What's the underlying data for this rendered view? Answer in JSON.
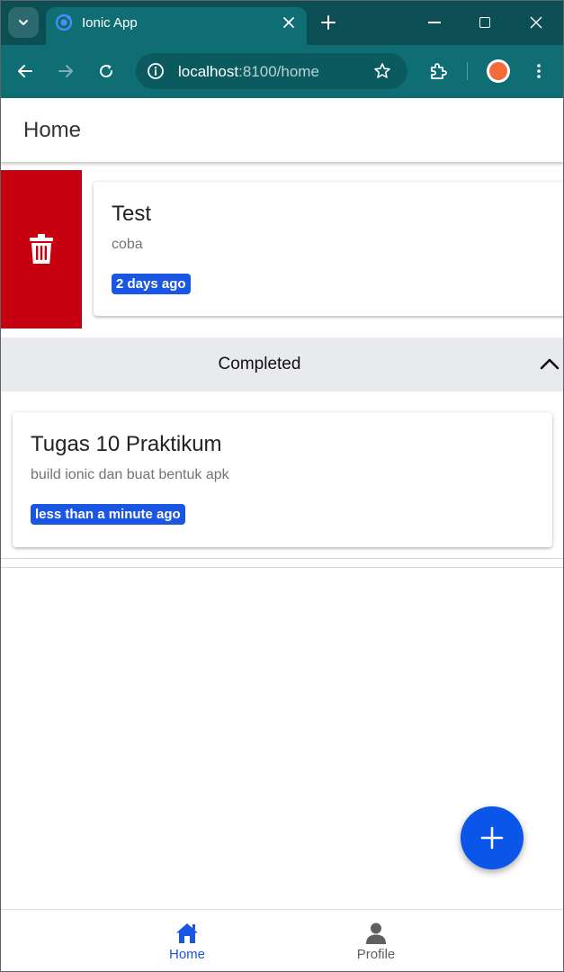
{
  "browser": {
    "tab_title": "Ionic App",
    "url_host": "localhost",
    "url_path": ":8100/home",
    "colors": {
      "tabstrip": "#0b4f55",
      "toolbar": "#0f6e73"
    }
  },
  "app": {
    "header_title": "Home",
    "active_items": [
      {
        "title": "Test",
        "description": "coba",
        "time": "2 days ago",
        "swipe_option": "delete"
      }
    ],
    "completed": {
      "label": "Completed",
      "expanded": true,
      "items": [
        {
          "title": "Tugas 10 Praktikum",
          "description": "build ionic dan buat bentuk apk",
          "time": "less than a minute ago"
        }
      ]
    },
    "fab_icon": "add-icon",
    "tabs": [
      {
        "label": "Home",
        "icon": "home-icon",
        "selected": true
      },
      {
        "label": "Profile",
        "icon": "person-icon",
        "selected": false
      }
    ],
    "colors": {
      "primary": "#1a55e3",
      "danger": "#c5000f",
      "tab_inactive": "#5f5f5f"
    }
  }
}
